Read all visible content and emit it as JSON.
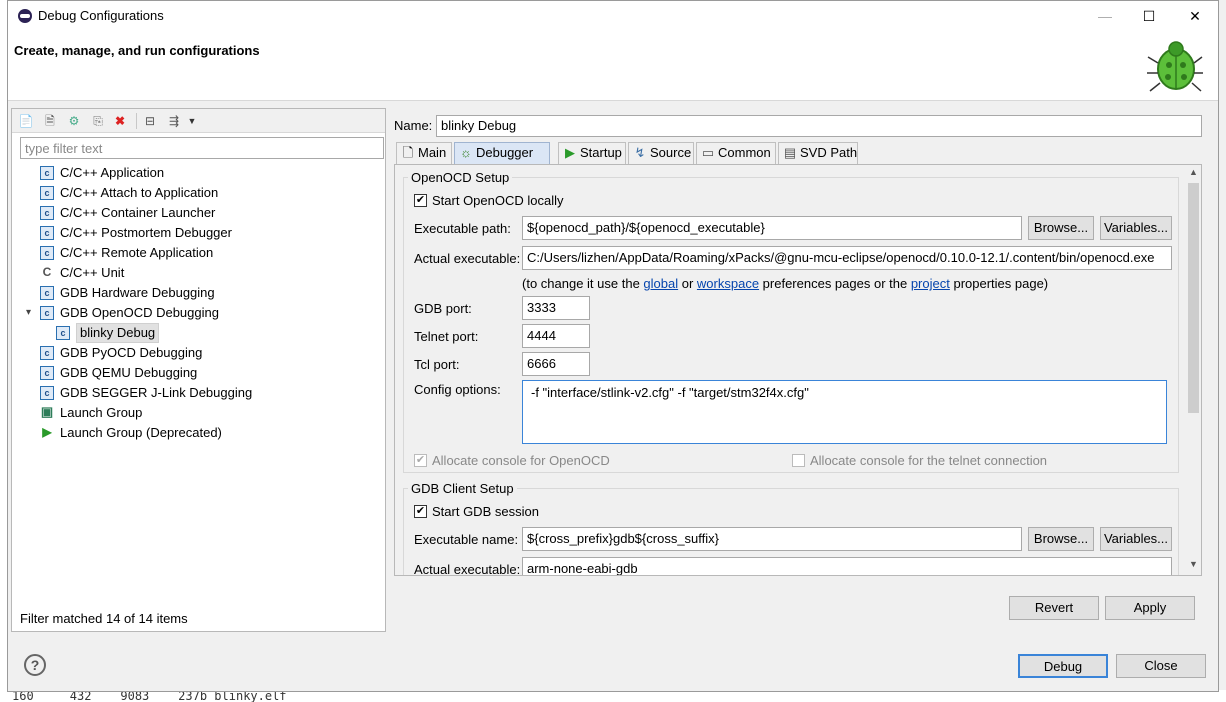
{
  "window": {
    "title": "Debug Configurations",
    "minimize": "—",
    "maximize": "☐",
    "close": "✕"
  },
  "header": {
    "text": "Create, manage, and run configurations"
  },
  "left": {
    "filter_placeholder": "type filter text",
    "tree": [
      {
        "label": "C/C++ Application",
        "icon": "c-icon"
      },
      {
        "label": "C/C++ Attach to Application",
        "icon": "c-icon"
      },
      {
        "label": "C/C++ Container Launcher",
        "icon": "c-icon"
      },
      {
        "label": "C/C++ Postmortem Debugger",
        "icon": "c-icon"
      },
      {
        "label": "C/C++ Remote Application",
        "icon": "c-icon"
      },
      {
        "label": "C/C++ Unit",
        "icon": "cu-icon"
      },
      {
        "label": "GDB Hardware Debugging",
        "icon": "c-icon"
      },
      {
        "label": "GDB OpenOCD Debugging",
        "icon": "c-icon",
        "expanded": true
      },
      {
        "label": "blinky Debug",
        "icon": "c-icon",
        "child": true,
        "selected": true
      },
      {
        "label": "GDB PyOCD Debugging",
        "icon": "c-icon"
      },
      {
        "label": "GDB QEMU Debugging",
        "icon": "c-icon"
      },
      {
        "label": "GDB SEGGER J-Link Debugging",
        "icon": "c-icon"
      },
      {
        "label": "Launch Group",
        "icon": "launch-group-icon"
      },
      {
        "label": "Launch Group (Deprecated)",
        "icon": "run-icon"
      }
    ],
    "status": "Filter matched 14 of 14 items"
  },
  "right": {
    "name_label": "Name:",
    "name_value": "blinky Debug",
    "tabs": [
      {
        "label": "Main",
        "icon": "main-icon"
      },
      {
        "label": "Debugger",
        "icon": "debugger-icon",
        "active": true
      },
      {
        "label": "Startup",
        "icon": "startup-icon"
      },
      {
        "label": "Source",
        "icon": "source-icon"
      },
      {
        "label": "Common",
        "icon": "common-icon"
      },
      {
        "label": "SVD Path",
        "icon": "svd-icon"
      }
    ],
    "openocd": {
      "title": "OpenOCD Setup",
      "start_locally": "Start OpenOCD locally",
      "exec_label": "Executable path:",
      "exec_value": "${openocd_path}/${openocd_executable}",
      "browse": "Browse...",
      "variables": "Variables...",
      "actual_label": "Actual executable:",
      "actual_value": "C:/Users/lizhen/AppData/Roaming/xPacks/@gnu-mcu-eclipse/openocd/0.10.0-12.1/.content/bin/openocd.exe",
      "hint_prefix": "(to change it use the ",
      "hint_global": "global",
      "hint_or": " or ",
      "hint_workspace": "workspace",
      "hint_mid": " preferences pages or the ",
      "hint_project": "project",
      "hint_suffix": " properties page)",
      "gdb_port_label": "GDB port:",
      "gdb_port": "3333",
      "telnet_port_label": "Telnet port:",
      "telnet_port": "4444",
      "tcl_port_label": "Tcl port:",
      "tcl_port": "6666",
      "config_label": "Config options:",
      "config_value": "-f \"interface/stlink-v2.cfg\" -f \"target/stm32f4x.cfg\"",
      "alloc_console": "Allocate console for OpenOCD",
      "alloc_telnet": "Allocate console for the telnet connection"
    },
    "gdb": {
      "title": "GDB Client Setup",
      "start_session": "Start GDB session",
      "exec_label": "Executable name:",
      "exec_value": "${cross_prefix}gdb${cross_suffix}",
      "browse": "Browse...",
      "variables": "Variables...",
      "actual_label": "Actual executable:",
      "actual_value": "arm-none-eabi-gdb"
    },
    "revert": "Revert",
    "apply": "Apply"
  },
  "footer": {
    "help": "?",
    "debug": "Debug",
    "close": "Close"
  },
  "background_text": "160     432    9083    237b blinky.elf"
}
